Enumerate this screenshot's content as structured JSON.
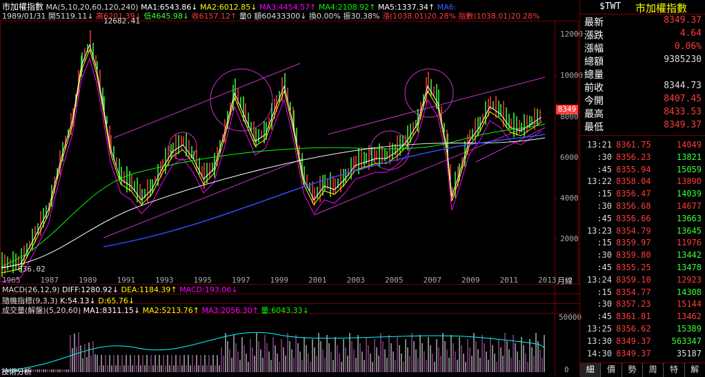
{
  "header": {
    "title": "市加權指數",
    "ma_line": "MA(5,10,20,60,120,240)",
    "ma1": "MA1:6543.86↓",
    "ma2": "MA2:6012.85↓",
    "ma3": "MA3:4454.57↑",
    "ma4": "MA4:2108.92↑",
    "ma5": "MA5:1337.34↑",
    "ma6": "MA6:",
    "date": "1989/01/31",
    "open": "開5119.11↓",
    "high": "高6201.39↓",
    "low": "低4645.98↓",
    "close": "收6157.12↑",
    "vol": "量0",
    "amount": "額60433300↓",
    "turnover": "換0.00%",
    "amplitude": "振30.38%",
    "change": "漲(1038.01)20.28%",
    "index_change": "指數(1038.01)20.28%"
  },
  "price_chart": {
    "peak_label": "12682.41",
    "low_label": "636.02",
    "current_tag": "8349",
    "y_ticks": [
      "12000",
      "10000",
      "8000",
      "6000",
      "4000",
      "2000"
    ],
    "x_ticks": [
      "1965",
      "1987",
      "1989",
      "1991",
      "1993",
      "1995",
      "1997",
      "1999",
      "2001",
      "2003",
      "2005",
      "2007",
      "2009",
      "2011",
      "2013"
    ],
    "period_label": "月線"
  },
  "macd": {
    "label": "MACD(26,12,9)",
    "diff": "DIFF:1280.92↓",
    "dea": "DEA:1184.39↑",
    "macd": "MACD:193.06↓"
  },
  "kdj": {
    "label": "隨機指標(9,3,3)",
    "k": "K:54.13↓",
    "d": "D:65.76↓"
  },
  "volume": {
    "label": "成交量(解盤)(5,20,60)",
    "ma1": "MA1:8311.15↓",
    "ma2": "MA2:5213.76↑",
    "ma3": "MA3:2056.30↑",
    "vol": "量:6043.33↓",
    "y_ticks": [
      "50000",
      "0"
    ],
    "bottom_label": "技術分析"
  },
  "quote": {
    "symbol": "$TWT",
    "name": "市加權指數",
    "stats": [
      {
        "label": "最新",
        "value": "8349.37",
        "color": "#ff3b3b"
      },
      {
        "label": "漲跌",
        "value": "4.64",
        "color": "#ff3b3b"
      },
      {
        "label": "漲幅",
        "value": "0.06%",
        "color": "#ff3b3b"
      },
      {
        "label": "總額",
        "value": "9385230",
        "color": "#dddddd"
      },
      {
        "label": "總量",
        "value": "",
        "color": "#dddddd"
      },
      {
        "label": "前收",
        "value": "8344.73",
        "color": "#dddddd"
      },
      {
        "label": "今開",
        "value": "8407.45",
        "color": "#ff3b3b"
      },
      {
        "label": "最高",
        "value": "8433.53",
        "color": "#ff3b3b"
      },
      {
        "label": "最低",
        "value": "8349.37",
        "color": "#ff3b3b"
      }
    ],
    "ticks": [
      {
        "time": "13:21",
        "price": "8361.75",
        "vol": "14049",
        "vcolor": "#ff3b3b"
      },
      {
        "time": ":30",
        "price": "8356.23",
        "vol": "13821",
        "vcolor": "#3bff3b"
      },
      {
        "time": ":45",
        "price": "8355.94",
        "vol": "15059",
        "vcolor": "#3bff3b"
      },
      {
        "time": "13:22",
        "price": "8358.04",
        "vol": "13890",
        "vcolor": "#ff3b3b"
      },
      {
        "time": ":15",
        "price": "8356.47",
        "vol": "14039",
        "vcolor": "#3bff3b"
      },
      {
        "time": ":30",
        "price": "8356.68",
        "vol": "14677",
        "vcolor": "#ff3b3b"
      },
      {
        "time": ":45",
        "price": "8356.66",
        "vol": "13663",
        "vcolor": "#3bff3b"
      },
      {
        "time": "13:23",
        "price": "8354.79",
        "vol": "13645",
        "vcolor": "#3bff3b"
      },
      {
        "time": ":15",
        "price": "8359.97",
        "vol": "11976",
        "vcolor": "#ff3b3b"
      },
      {
        "time": ":30",
        "price": "8359.80",
        "vol": "13442",
        "vcolor": "#3bff3b"
      },
      {
        "time": ":45",
        "price": "8355.25",
        "vol": "13478",
        "vcolor": "#3bff3b"
      },
      {
        "time": "13:24",
        "price": "8359.10",
        "vol": "12923",
        "vcolor": "#ff3b3b"
      },
      {
        "time": ":15",
        "price": "8354.77",
        "vol": "14308",
        "vcolor": "#3bff3b"
      },
      {
        "time": ":30",
        "price": "8357.23",
        "vol": "15144",
        "vcolor": "#ff3b3b"
      },
      {
        "time": ":45",
        "price": "8361.81",
        "vol": "13462",
        "vcolor": "#ff3b3b"
      },
      {
        "time": "13:25",
        "price": "8356.62",
        "vol": "15389",
        "vcolor": "#3bff3b"
      },
      {
        "time": "13:30",
        "price": "8349.37",
        "vol": "563347",
        "vcolor": "#3bff3b"
      },
      {
        "time": "14:30",
        "price": "8349.37",
        "vol": "35187",
        "vcolor": "#dddddd"
      }
    ]
  },
  "tabs": [
    "細",
    "價",
    "勢",
    "周",
    "特",
    "解"
  ],
  "colors": {
    "up": "#ff3b3b",
    "down": "#3bff3b",
    "ma1": "#ffffff",
    "ma2": "#ffff00",
    "ma3": "#ff00ff",
    "ma4": "#00ff00",
    "ma5": "#ffffff",
    "ma6": "#4040ff",
    "trend": "#cc33cc",
    "border": "#7a0000"
  }
}
